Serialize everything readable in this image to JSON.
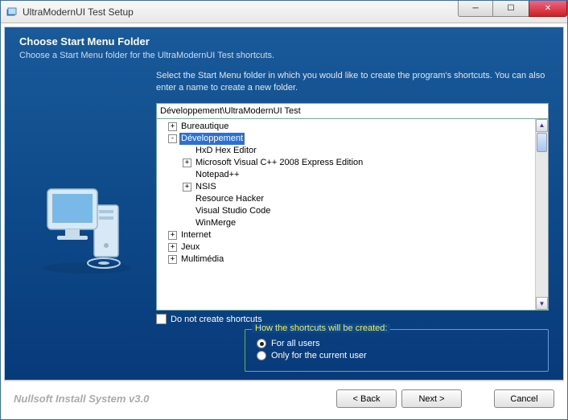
{
  "window": {
    "title": "UltraModernUI Test Setup"
  },
  "header": {
    "title": "Choose Start Menu Folder",
    "subtitle": "Choose a Start Menu folder for the UltraModernUI Test shortcuts."
  },
  "instruction": "Select the Start Menu folder in which you would like to create the program's shortcuts. You can also enter a name to create a new folder.",
  "path_value": "Développement\\UltraModernUI Test",
  "tree": [
    {
      "level": 0,
      "exp": "+",
      "label": "Bureautique",
      "sel": false
    },
    {
      "level": 0,
      "exp": "-",
      "label": "Développement",
      "sel": true
    },
    {
      "level": 1,
      "exp": "",
      "label": "HxD Hex Editor",
      "sel": false
    },
    {
      "level": 1,
      "exp": "+",
      "label": "Microsoft Visual C++ 2008 Express Edition",
      "sel": false
    },
    {
      "level": 1,
      "exp": "",
      "label": "Notepad++",
      "sel": false
    },
    {
      "level": 1,
      "exp": "+",
      "label": "NSIS",
      "sel": false
    },
    {
      "level": 1,
      "exp": "",
      "label": "Resource Hacker",
      "sel": false
    },
    {
      "level": 1,
      "exp": "",
      "label": "Visual Studio Code",
      "sel": false
    },
    {
      "level": 1,
      "exp": "",
      "label": "WinMerge",
      "sel": false
    },
    {
      "level": 0,
      "exp": "+",
      "label": "Internet",
      "sel": false
    },
    {
      "level": 0,
      "exp": "+",
      "label": "Jeux",
      "sel": false
    },
    {
      "level": 0,
      "exp": "+",
      "label": "Multimédia",
      "sel": false
    }
  ],
  "checkbox_label": "Do not create shortcuts",
  "fieldset": {
    "legend": "How the shortcuts will be created:",
    "opt1": "For all users",
    "opt2": "Only for the current user"
  },
  "footer": {
    "brand": "Nullsoft Install System v3.0",
    "back": "< Back",
    "next": "Next >",
    "cancel": "Cancel"
  }
}
